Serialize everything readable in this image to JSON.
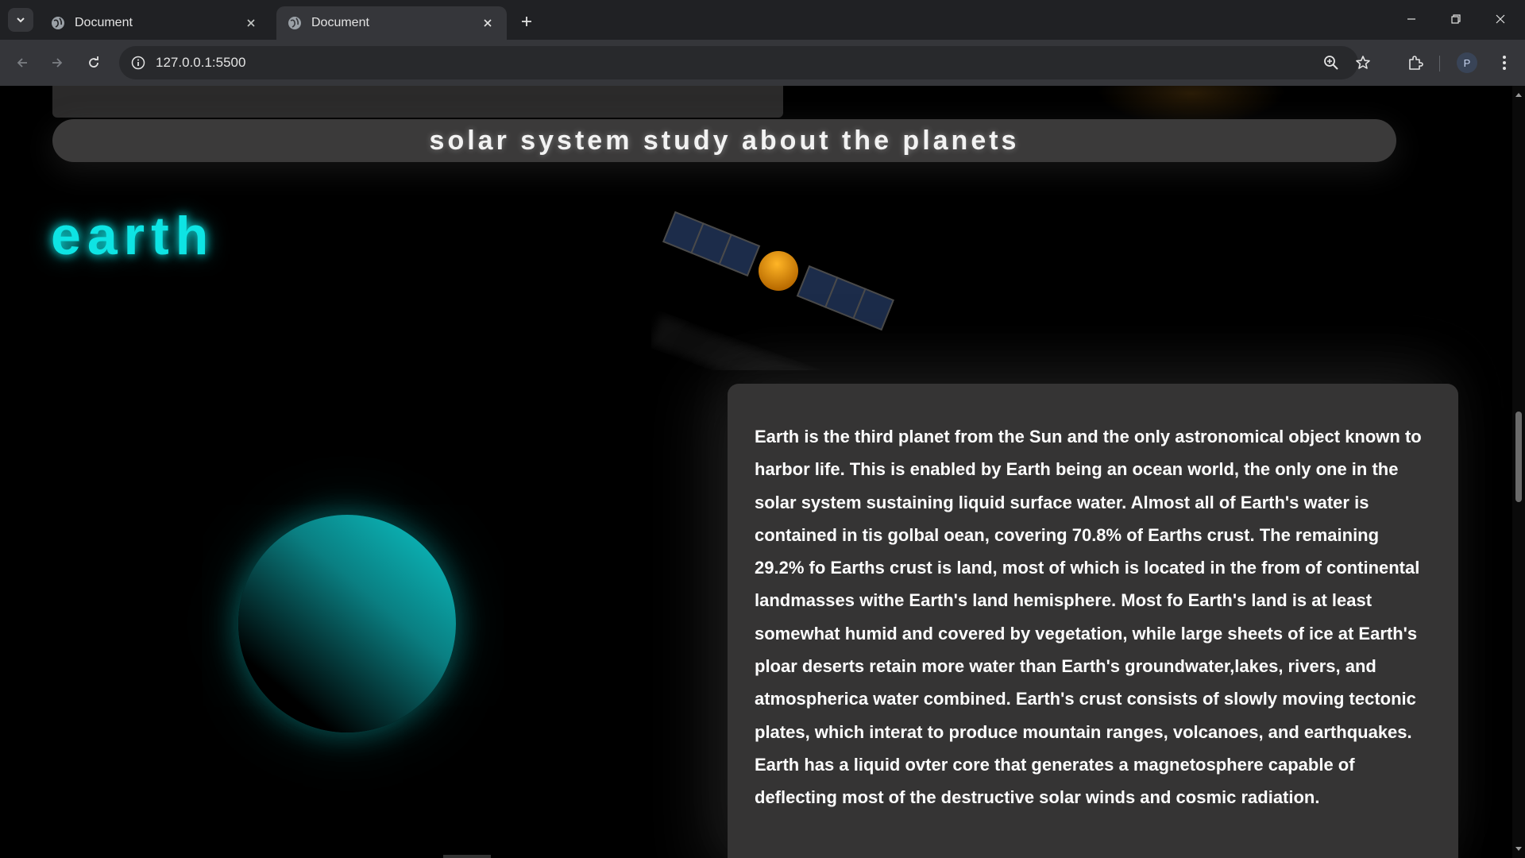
{
  "browser": {
    "tabs": [
      {
        "title": "Document",
        "active": false
      },
      {
        "title": "Document",
        "active": true
      }
    ],
    "url": "127.0.0.1:5500",
    "profile_initial": "P"
  },
  "page": {
    "header_title": "solar system study about the planets",
    "planet_name": "earth",
    "description": "Earth is the third planet from the Sun and the only astronomical object known to harbor life. This is enabled by Earth being an ocean world, the only one in the solar system sustaining liquid surface water. Almost all of Earth's water is contained in tis golbal oean, covering 70.8% of Earths crust. The remaining 29.2% fo Earths crust is land, most of which is located in the from of continental landmasses withe Earth's land hemisphere. Most fo Earth's land is at least somewhat humid and covered by vegetation, while large sheets of ice at Earth's ploar deserts retain more water than Earth's groundwater,lakes, rivers, and atmospherica water combined. Earth's crust consists of slowly moving tectonic plates, which interat to produce mountain ranges, volcanoes, and earthquakes. Earth has a liquid ovter core that generates a magnetosphere capable of deflecting most of the destructive solar winds and cosmic radiation."
  },
  "colors": {
    "accent_cyan": "#0ee4e4",
    "card_bg": "#353434",
    "header_bg": "#3b3a3a",
    "satellite_body": "#f0a010",
    "satellite_panel": "#1c2c4a"
  },
  "icons": {
    "tab_search": "chevron-down-icon",
    "favicon": "globe-icon",
    "close": "close-icon",
    "new_tab": "plus-icon",
    "back": "back-arrow-icon",
    "forward": "forward-arrow-icon",
    "reload": "reload-icon",
    "site_info": "info-icon",
    "zoom": "zoom-icon",
    "bookmark": "star-icon",
    "extensions": "puzzle-icon",
    "menu": "kebab-menu-icon"
  }
}
